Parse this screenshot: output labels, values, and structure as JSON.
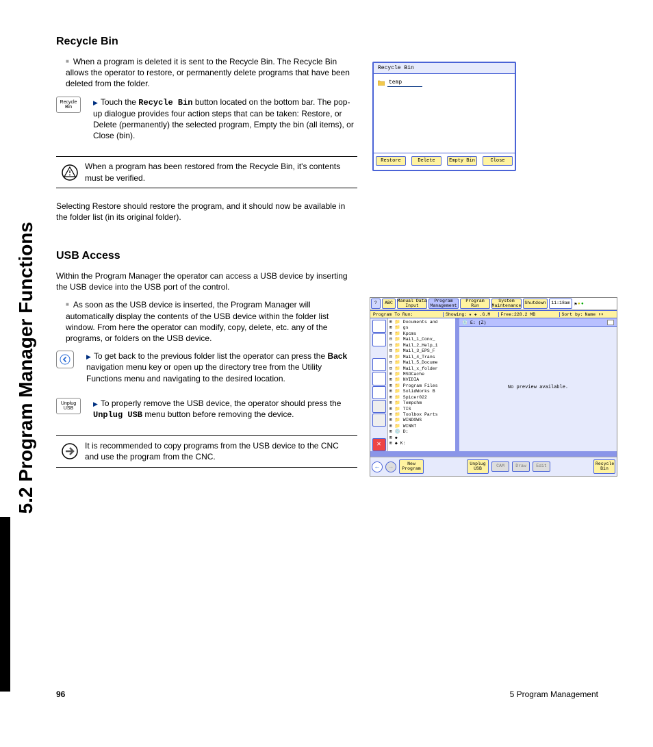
{
  "side_heading": "5.2 Program Manager Functions",
  "section1": {
    "heading": "Recycle Bin",
    "p1": "When a program is deleted it is sent to the Recycle Bin.  The Recycle Bin allows the operator to restore, or permanently delete programs that have been deleted from the folder.",
    "key1_label": "Recycle\nBin",
    "step1_prefix": "Touch the ",
    "step1_bold": "Recycle Bin",
    "step1_suffix": " button located on the bottom bar.  The pop-up dialogue provides four action steps that can be taken: Restore, or Delete (permanently) the selected program, Empty the bin (all items), or Close (bin).",
    "note1": "When a program has been restored from the Recycle Bin, it's contents must be verified.",
    "p2": "Selecting Restore should restore the program, and it should now be available in the folder list (in its original folder)."
  },
  "section2": {
    "heading": "USB Access",
    "p1": "Within the Program Manager the operator can access a USB device by inserting the USB device into the USB port of the control.",
    "p2": "As soon as the USB device is inserted, the Program Manager will automatically display the contents of the USB device within the folder list window.  From here the operator can modify, copy, delete, etc. any of the programs, or folders on the USB device.",
    "step1_prefix": "To get back to the previous folder list the operator can press the ",
    "step1_bold": "Back",
    "step1_suffix": " navigation menu key or open up the directory tree from the Utility Functions menu and navigating to the desired location.",
    "key2_label": "Unplug\nUSB",
    "step2_prefix": "To properly remove the USB device, the operator should press the ",
    "step2_bold": "Unplug USB",
    "step2_suffix": " menu button before removing the device.",
    "note2": "It is recommended to copy programs from the USB device to the CNC and use the program from the CNC."
  },
  "fig1": {
    "title": "Recycle Bin",
    "file": "temp",
    "buttons": [
      "Restore",
      "Delete",
      "Empty Bin",
      "Close"
    ]
  },
  "fig2": {
    "menu": {
      "q": "?",
      "abc": "ABC",
      "mdi": "Manual Data\nInput",
      "pm": "Program\nManagement",
      "pr": "Program Run",
      "sm": "System\nMaintenance",
      "sd": "Shutdown",
      "time": "11:18am"
    },
    "status": {
      "ptr": "Program To Run:",
      "showing": "Showing:",
      "filter": "★ ✚ .G.M",
      "free": "Free:228.2 MB",
      "sort": "Sort by:",
      "sortval": "Name ⬆⬇"
    },
    "tree": [
      "⊞ 📁 Documents and",
      "⊞ 📁 gs",
      "⊞ 📁 Kpcms",
      "⊟ 📁 Mail_1_Conv_",
      "⊟ 📁 Mail_2_Help_1",
      "⊟ 📁 Mail_3_EPS_F",
      "⊟ 📁 Mail_4_Trans",
      "⊟ 📁 Mail_5_Docume",
      "⊟ 📁 Mail_x_folder",
      "⊞ 📁 MSOCache",
      "⊞ 📁 NVIDIA",
      "⊞ 📁 Program Files",
      "⊞ 📁 SolidWorks B",
      "⊞ 📁 Spicer022",
      "⊞ 📁 Tempchm",
      "⊞ 📁 TIS",
      "⊞ 📁 Toolbox Parts",
      "⊞ 📁 WINDOWS",
      "⊞ 📁 WINNT",
      "⊞ 💿 D:",
      "⊞ ◆",
      "⊞ ◆ K:"
    ],
    "preview_head": "💿 E: (Z)",
    "preview_msg": "No preview available.",
    "bottom": {
      "new": "New\nProgram",
      "unplug": "Unplug\nUSB",
      "cam": "CAM",
      "draw": "Draw",
      "edit": "Edit",
      "recycle": "Recycle\nBin"
    }
  },
  "footer": {
    "page": "96",
    "chapter": "5 Program Management"
  }
}
